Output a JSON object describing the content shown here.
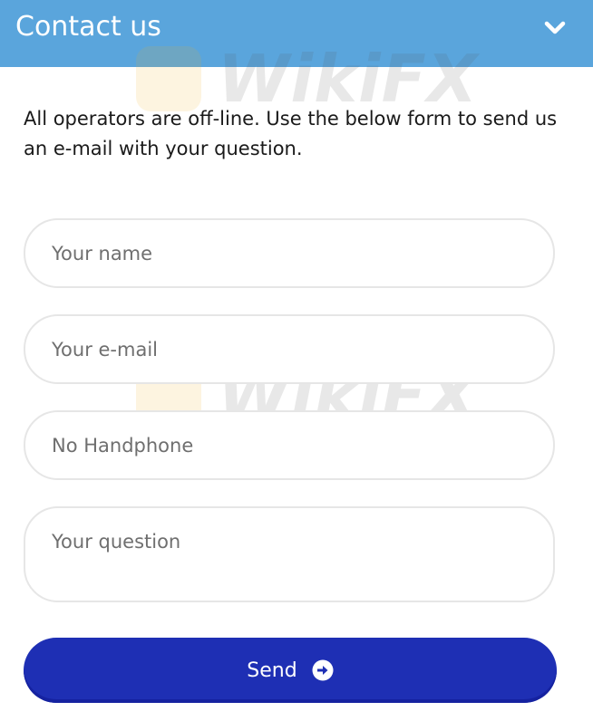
{
  "header": {
    "title": "Contact us",
    "toggle_icon": "chevron-down-icon",
    "background_color": "#5aa5dc"
  },
  "intro_text": "All operators are off-line. Use the below form to send us an e-mail with your question.",
  "form": {
    "name": {
      "placeholder": "Your name",
      "value": ""
    },
    "email": {
      "placeholder": "Your e-mail",
      "value": ""
    },
    "phone": {
      "placeholder": "No Handphone",
      "value": ""
    },
    "question": {
      "placeholder": "Your question",
      "value": ""
    }
  },
  "send_button": {
    "label": "Send",
    "icon": "arrow-right-circle-icon",
    "color": "#1e2fb4"
  },
  "watermark": {
    "text": "WikiFX"
  }
}
